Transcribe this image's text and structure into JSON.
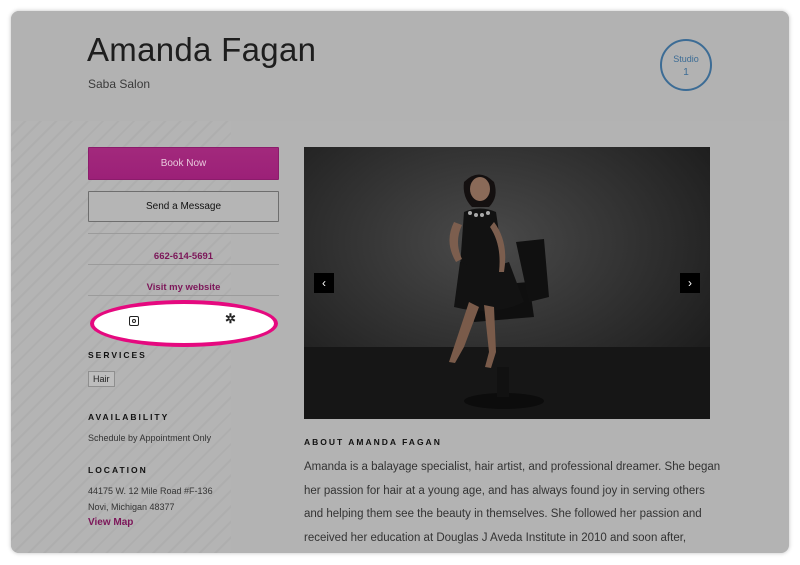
{
  "header": {
    "name": "Amanda Fagan",
    "salon": "Saba Salon",
    "studio_label": "Studio",
    "studio_number": "1"
  },
  "sidebar": {
    "book_label": "Book Now",
    "message_label": "Send a Message",
    "phone": "662-614-5691",
    "website_label": "Visit my website",
    "social": [
      "instagram-icon",
      "yelp-icon"
    ],
    "services_heading": "SERVICES",
    "services": [
      "Hair"
    ],
    "availability_heading": "AVAILABILITY",
    "availability": "Schedule by Appointment Only",
    "location_heading": "LOCATION",
    "address_line1": "44175 W. 12 Mile Road #F-136",
    "address_line2": "Novi, Michigan 48377",
    "view_map_label": "View Map"
  },
  "gallery": {
    "prev_icon": "chevron-left-icon",
    "next_icon": "chevron-right-icon",
    "prev_glyph": "‹",
    "next_glyph": "›"
  },
  "about": {
    "heading": "ABOUT AMANDA FAGAN",
    "lines": [
      "Amanda is a balayage specialist, hair artist, and professional dreamer. She began",
      "her passion for hair at a young age, and has always found joy in serving others",
      "and helping them see the beauty in themselves. She followed her passion and",
      "received her education at Douglas J Aveda Institute in 2010 and soon after,"
    ]
  },
  "colors": {
    "accent": "#9c2078",
    "highlight": "#e5097f",
    "studio_badge": "#3c6c95"
  }
}
